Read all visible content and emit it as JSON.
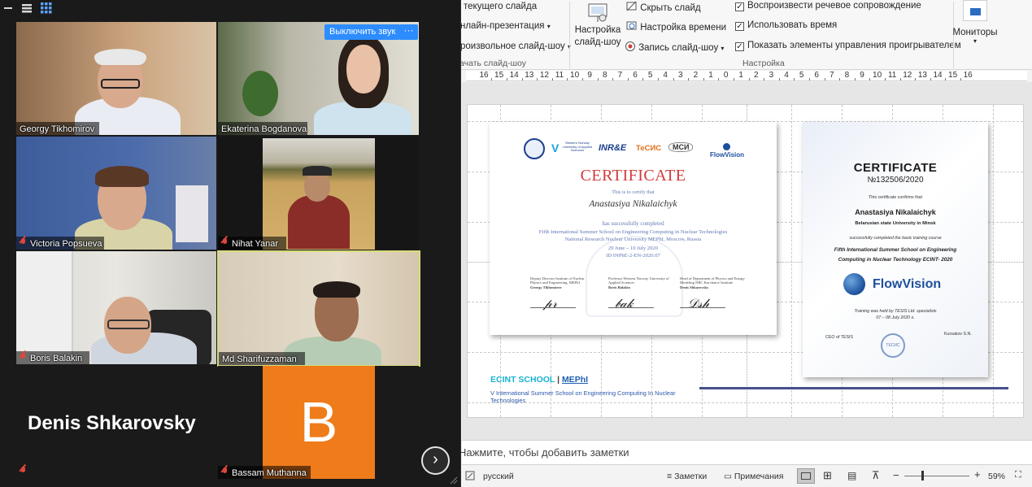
{
  "ribbon": {
    "col1": [
      "текущего слайда",
      "нлайн-презентация",
      "роизвольное слайд-шоу"
    ],
    "col1_group": "ачать слайд-шоу",
    "setup_button": [
      "Настройка",
      "слайд-шоу"
    ],
    "hide_slide": "Скрыть слайд",
    "rehearse": "Настройка времени",
    "record": "Запись слайд-шоу",
    "opt_narration": "Воспроизвести речевое сопровождение",
    "opt_timings": "Использовать время",
    "opt_controls": "Показать элементы управления проигрывателем",
    "group_setup": "Настройка",
    "monitors": "Мониторы"
  },
  "ruler": {
    "labels": [
      "16",
      "15",
      "14",
      "13",
      "12",
      "11",
      "10",
      "9",
      "8",
      "7",
      "6",
      "5",
      "4",
      "3",
      "2",
      "1",
      "0",
      "1",
      "2",
      "3",
      "4",
      "5",
      "6",
      "7",
      "8",
      "9",
      "10",
      "11",
      "12",
      "13",
      "14",
      "15",
      "16"
    ]
  },
  "slide": {
    "cert1": {
      "logos": [
        "Western Norway University of Applied Sciences",
        "INR&E",
        "ТеСИС",
        "МСИ",
        "FlowVision"
      ],
      "title": "CERTIFICATE",
      "certify": "This is to certify that",
      "name": "Anastasiya Nikalaichyk",
      "completed": "has successfully completed",
      "school": "Fifth International Summer School on Engineering Computing in Nuclear Technologies",
      "university": "National Research Nuclear University MEPhI, Moscow, Russia",
      "dates": "29 June – 10 July 2020",
      "id": "ID INPhE-2-EN-2020.07",
      "signers": [
        {
          "role": "Deputy Director Institute of Nuclear Physics and Engineering, MEPhI",
          "name": "Georgy Tikhomirov"
        },
        {
          "role": "Professor Western Norway University of Applied Sciences",
          "name": "Boris Balakin"
        },
        {
          "role": "Head of Department of Physics and Energy Modeling NRC Kurchatov Institute",
          "name": "Denis Shkarovsky"
        }
      ]
    },
    "cert2": {
      "title": "CERTIFICATE",
      "number": "№132506/2020",
      "confirms": "This certificate confirms that",
      "name": "Anastasiya Nikalaichyk",
      "university": "Belarusian state University in Minsk",
      "completed": "successfully completed the basic training course",
      "course1": "Fifth International Summer School on Engineering",
      "course2": "Computing in Nuclear Technology ECINT- 2020",
      "brand": "FlowVision",
      "held1": "Training was held by TESIS Ltd. specialists",
      "held2": "07 – 08 July 2020 г.",
      "ceo": "CEO of TESIS",
      "signer": "Kursakov S.N.",
      "seal": "ТЕСИС"
    },
    "ecint_title": "ECINT SCHOOL",
    "ecint_sep": " | ",
    "ecint_link": "MEPhI",
    "ecint_sub": "V International Summer School on Engineering  Computing In Nuclear Technologies"
  },
  "notes_placeholder": "Нажмите, чтобы добавить заметки",
  "status": {
    "language": "русский",
    "notes": "Заметки",
    "comments": "Примечания",
    "zoom": "59%",
    "zoom_fraction": 0.59
  },
  "zoom": {
    "unmute_label": "Выключить звук",
    "more_label": "···",
    "participants": [
      {
        "name": "Georgy Tikhomirov",
        "muted": false
      },
      {
        "name": "Ekaterina Bogdanova",
        "muted": false
      },
      {
        "name": "Victoria Popsueva",
        "muted": true
      },
      {
        "name": "Nihat Yanar",
        "muted": true
      },
      {
        "name": "Boris Balakin",
        "muted": true
      },
      {
        "name": "Md Sharifuzzaman",
        "muted": false
      },
      {
        "name": "Denis Shkarovsky",
        "muted": true
      },
      {
        "name": "Bassam Muthanna",
        "muted": true
      }
    ],
    "avatar_letter": "B",
    "avatar_color": "#ef7b1a",
    "active_speaker_color": "#d7dc7b"
  }
}
